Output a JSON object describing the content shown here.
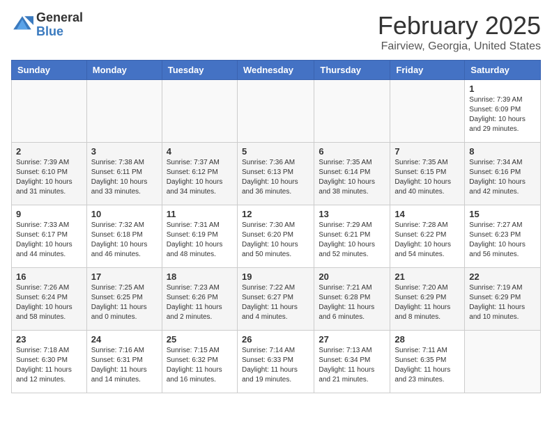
{
  "logo": {
    "general": "General",
    "blue": "Blue"
  },
  "title": "February 2025",
  "location": "Fairview, Georgia, United States",
  "days_of_week": [
    "Sunday",
    "Monday",
    "Tuesday",
    "Wednesday",
    "Thursday",
    "Friday",
    "Saturday"
  ],
  "weeks": [
    [
      {
        "day": "",
        "info": ""
      },
      {
        "day": "",
        "info": ""
      },
      {
        "day": "",
        "info": ""
      },
      {
        "day": "",
        "info": ""
      },
      {
        "day": "",
        "info": ""
      },
      {
        "day": "",
        "info": ""
      },
      {
        "day": "1",
        "info": "Sunrise: 7:39 AM\nSunset: 6:09 PM\nDaylight: 10 hours\nand 29 minutes."
      }
    ],
    [
      {
        "day": "2",
        "info": "Sunrise: 7:39 AM\nSunset: 6:10 PM\nDaylight: 10 hours\nand 31 minutes."
      },
      {
        "day": "3",
        "info": "Sunrise: 7:38 AM\nSunset: 6:11 PM\nDaylight: 10 hours\nand 33 minutes."
      },
      {
        "day": "4",
        "info": "Sunrise: 7:37 AM\nSunset: 6:12 PM\nDaylight: 10 hours\nand 34 minutes."
      },
      {
        "day": "5",
        "info": "Sunrise: 7:36 AM\nSunset: 6:13 PM\nDaylight: 10 hours\nand 36 minutes."
      },
      {
        "day": "6",
        "info": "Sunrise: 7:35 AM\nSunset: 6:14 PM\nDaylight: 10 hours\nand 38 minutes."
      },
      {
        "day": "7",
        "info": "Sunrise: 7:35 AM\nSunset: 6:15 PM\nDaylight: 10 hours\nand 40 minutes."
      },
      {
        "day": "8",
        "info": "Sunrise: 7:34 AM\nSunset: 6:16 PM\nDaylight: 10 hours\nand 42 minutes."
      }
    ],
    [
      {
        "day": "9",
        "info": "Sunrise: 7:33 AM\nSunset: 6:17 PM\nDaylight: 10 hours\nand 44 minutes."
      },
      {
        "day": "10",
        "info": "Sunrise: 7:32 AM\nSunset: 6:18 PM\nDaylight: 10 hours\nand 46 minutes."
      },
      {
        "day": "11",
        "info": "Sunrise: 7:31 AM\nSunset: 6:19 PM\nDaylight: 10 hours\nand 48 minutes."
      },
      {
        "day": "12",
        "info": "Sunrise: 7:30 AM\nSunset: 6:20 PM\nDaylight: 10 hours\nand 50 minutes."
      },
      {
        "day": "13",
        "info": "Sunrise: 7:29 AM\nSunset: 6:21 PM\nDaylight: 10 hours\nand 52 minutes."
      },
      {
        "day": "14",
        "info": "Sunrise: 7:28 AM\nSunset: 6:22 PM\nDaylight: 10 hours\nand 54 minutes."
      },
      {
        "day": "15",
        "info": "Sunrise: 7:27 AM\nSunset: 6:23 PM\nDaylight: 10 hours\nand 56 minutes."
      }
    ],
    [
      {
        "day": "16",
        "info": "Sunrise: 7:26 AM\nSunset: 6:24 PM\nDaylight: 10 hours\nand 58 minutes."
      },
      {
        "day": "17",
        "info": "Sunrise: 7:25 AM\nSunset: 6:25 PM\nDaylight: 11 hours\nand 0 minutes."
      },
      {
        "day": "18",
        "info": "Sunrise: 7:23 AM\nSunset: 6:26 PM\nDaylight: 11 hours\nand 2 minutes."
      },
      {
        "day": "19",
        "info": "Sunrise: 7:22 AM\nSunset: 6:27 PM\nDaylight: 11 hours\nand 4 minutes."
      },
      {
        "day": "20",
        "info": "Sunrise: 7:21 AM\nSunset: 6:28 PM\nDaylight: 11 hours\nand 6 minutes."
      },
      {
        "day": "21",
        "info": "Sunrise: 7:20 AM\nSunset: 6:29 PM\nDaylight: 11 hours\nand 8 minutes."
      },
      {
        "day": "22",
        "info": "Sunrise: 7:19 AM\nSunset: 6:29 PM\nDaylight: 11 hours\nand 10 minutes."
      }
    ],
    [
      {
        "day": "23",
        "info": "Sunrise: 7:18 AM\nSunset: 6:30 PM\nDaylight: 11 hours\nand 12 minutes."
      },
      {
        "day": "24",
        "info": "Sunrise: 7:16 AM\nSunset: 6:31 PM\nDaylight: 11 hours\nand 14 minutes."
      },
      {
        "day": "25",
        "info": "Sunrise: 7:15 AM\nSunset: 6:32 PM\nDaylight: 11 hours\nand 16 minutes."
      },
      {
        "day": "26",
        "info": "Sunrise: 7:14 AM\nSunset: 6:33 PM\nDaylight: 11 hours\nand 19 minutes."
      },
      {
        "day": "27",
        "info": "Sunrise: 7:13 AM\nSunset: 6:34 PM\nDaylight: 11 hours\nand 21 minutes."
      },
      {
        "day": "28",
        "info": "Sunrise: 7:11 AM\nSunset: 6:35 PM\nDaylight: 11 hours\nand 23 minutes."
      },
      {
        "day": "",
        "info": ""
      }
    ]
  ]
}
